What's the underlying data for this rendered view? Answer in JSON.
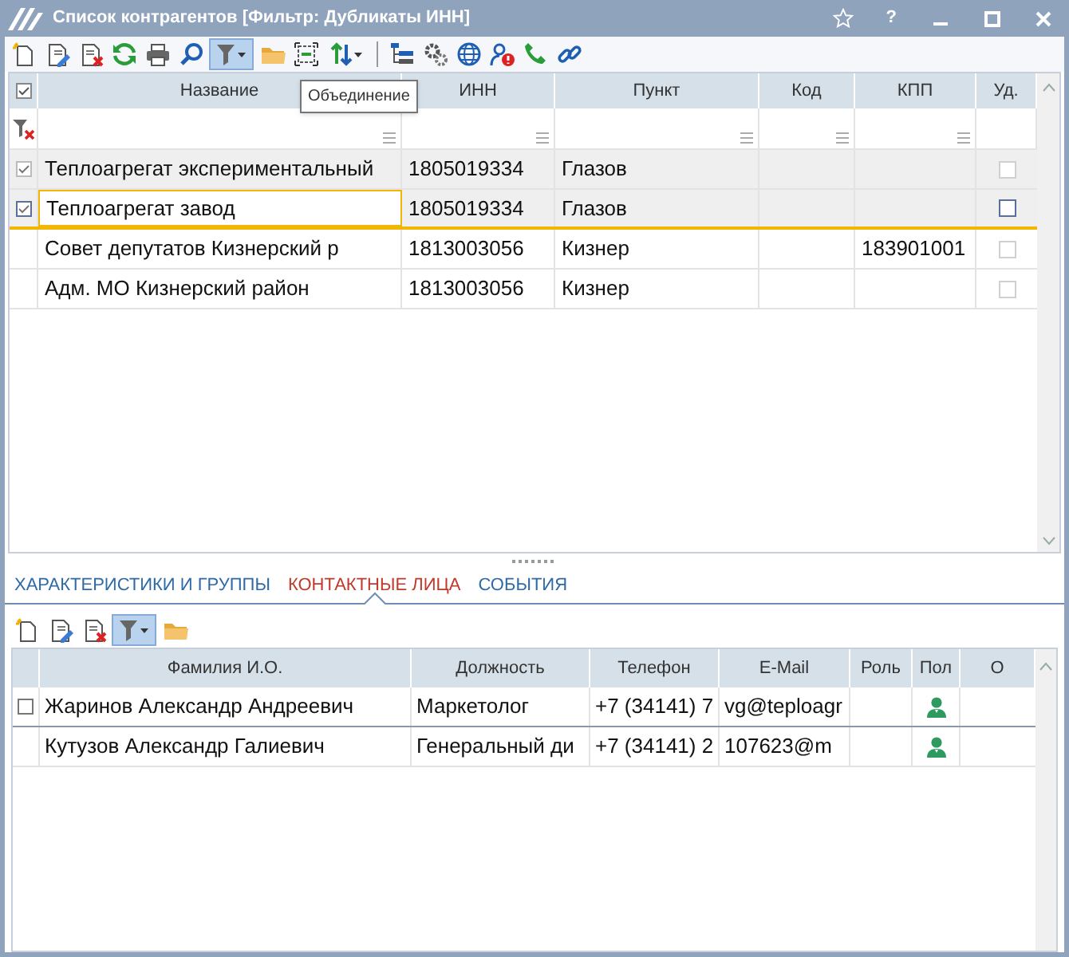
{
  "window": {
    "title": "Список контрагентов [Фильтр: Дубликаты ИНН]",
    "help": "?"
  },
  "toolbar": [
    {
      "kind": "new",
      "pressed": false
    },
    {
      "kind": "edit",
      "pressed": false
    },
    {
      "kind": "delete",
      "pressed": false
    },
    {
      "kind": "refresh",
      "pressed": false
    },
    {
      "kind": "print",
      "pressed": false
    },
    {
      "kind": "search",
      "pressed": false
    },
    {
      "kind": "filter",
      "pressed": true
    },
    {
      "kind": "folder",
      "pressed": false
    },
    {
      "kind": "merge",
      "pressed": false
    },
    {
      "kind": "sort",
      "pressed": false
    },
    {
      "kind": "sep"
    },
    {
      "kind": "tree",
      "pressed": false
    },
    {
      "kind": "gears",
      "pressed": false
    },
    {
      "kind": "globe",
      "pressed": false
    },
    {
      "kind": "person",
      "pressed": false
    },
    {
      "kind": "phone",
      "pressed": false
    },
    {
      "kind": "link",
      "pressed": false
    }
  ],
  "tooltip": "Объединение",
  "table": {
    "select_all": {
      "checked": true
    },
    "columns": [
      "Название",
      "ИНН",
      "Пункт",
      "Код",
      "КПП",
      "Уд."
    ],
    "rows": [
      {
        "cells": [
          "Теплоагрегат экспериментальный",
          "1805019334",
          "Глазов",
          "",
          ""
        ],
        "checked": true,
        "selected": true,
        "focused": false,
        "deleted": false
      },
      {
        "cells": [
          "Теплоагрегат завод",
          "1805019334",
          "Глазов",
          "",
          ""
        ],
        "checked": true,
        "selected": true,
        "focused": true,
        "deleted": false
      },
      {
        "cells": [
          "Совет депутатов Кизнерский р",
          "1813003056",
          "Кизнер",
          "",
          "183901001"
        ],
        "checked": false,
        "selected": false,
        "focused": false,
        "deleted": false
      },
      {
        "cells": [
          "Адм. МО Кизнерский район",
          "1813003056",
          "Кизнер",
          "",
          ""
        ],
        "checked": false,
        "selected": false,
        "focused": false,
        "deleted": false
      }
    ]
  },
  "tabs": [
    {
      "label": "ХАРАКТЕРИСТИКИ И ГРУППЫ",
      "selected": false
    },
    {
      "label": "КОНТАКТНЫЕ ЛИЦА",
      "selected": true
    },
    {
      "label": "СОБЫТИЯ",
      "selected": false
    }
  ],
  "contacts_toolbar": [
    {
      "kind": "new",
      "pressed": false
    },
    {
      "kind": "edit",
      "pressed": false
    },
    {
      "kind": "delete",
      "pressed": false
    },
    {
      "kind": "filter",
      "pressed": true
    },
    {
      "kind": "folder",
      "pressed": false
    }
  ],
  "contacts": {
    "columns": [
      "Фамилия И.О.",
      "Должность",
      "Телефон",
      "E-Mail",
      "Роль",
      "Пол",
      "О"
    ],
    "rows": [
      {
        "cells": [
          "Жаринов Александр Андреевич",
          "Маркетолог",
          "+7 (34141) 7",
          "vg@teploagr",
          ""
        ],
        "selected": true
      },
      {
        "cells": [
          "Кутузов Александр Галиевич",
          "Генеральный ди",
          "+7 (34141) 2",
          "107623@m",
          ""
        ],
        "selected": false
      }
    ]
  }
}
